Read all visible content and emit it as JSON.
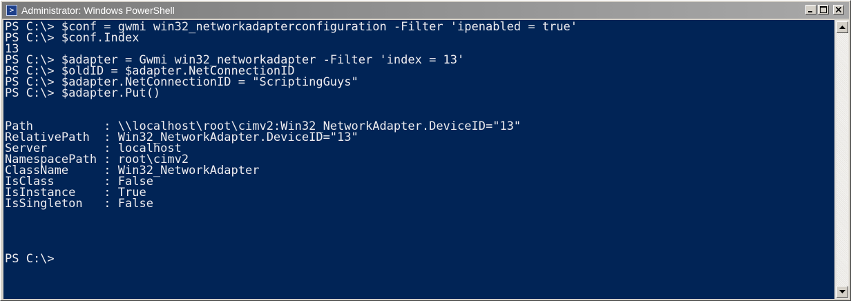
{
  "window": {
    "title": "Administrator: Windows PowerShell",
    "app_icon_glyph": ">",
    "icons": {
      "app": "powershell-icon",
      "minimize": "minimize-icon",
      "maximize": "maximize-icon",
      "close": "close-icon",
      "scroll_up": "chevron-up-icon",
      "scroll_down": "chevron-down-icon"
    }
  },
  "console": {
    "colors": {
      "background": "#012456",
      "foreground": "#eeedf0"
    },
    "lines": [
      "PS C:\\> $conf = gwmi win32_networkadapterconfiguration -Filter 'ipenabled = true'",
      "PS C:\\> $conf.Index",
      "13",
      "PS C:\\> $adapter = Gwmi win32_networkadapter -Filter 'index = 13'",
      "PS C:\\> $oldID = $adapter.NetConnectionID",
      "PS C:\\> $adapter.NetConnectionID = \"ScriptingGuys\"",
      "PS C:\\> $adapter.Put()",
      "",
      "",
      "Path          : \\\\localhost\\root\\cimv2:Win32_NetworkAdapter.DeviceID=\"13\"",
      "RelativePath  : Win32_NetworkAdapter.DeviceID=\"13\"",
      "Server        : localhost",
      "NamespacePath : root\\cimv2",
      "ClassName     : Win32_NetworkAdapter",
      "IsClass       : False",
      "IsInstance    : True",
      "IsSingleton   : False",
      "",
      "",
      "",
      "",
      "PS C:\\>"
    ]
  }
}
